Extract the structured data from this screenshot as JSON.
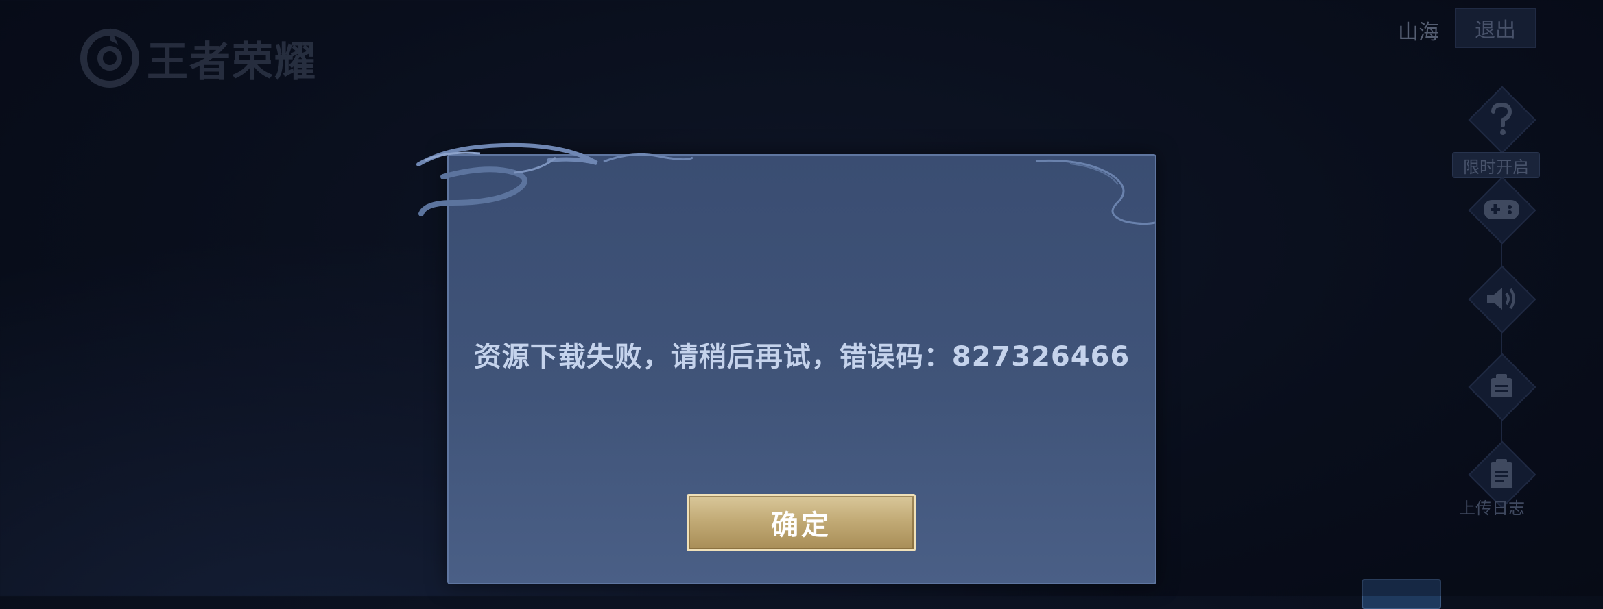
{
  "header": {
    "game_logo_text": "王者荣耀",
    "user_name": "山海",
    "exit_label": "退出"
  },
  "side_menu": {
    "help_icon": "question-icon",
    "limited_badge": "限时开启",
    "gamepad_icon": "gamepad-icon",
    "sound_icon": "speaker-icon",
    "notice_icon": "notice-icon",
    "upload_log_icon": "clipboard-icon",
    "upload_log_label": "上传日志"
  },
  "dialog": {
    "message": "资源下载失败，请稍后再试，错误码：827326466",
    "confirm_label": "确定"
  },
  "colors": {
    "dialog_bg": "#3d5077",
    "dialog_border": "#5f76a0",
    "confirm_gold": "#c2ab76",
    "background": "#0b1120"
  }
}
